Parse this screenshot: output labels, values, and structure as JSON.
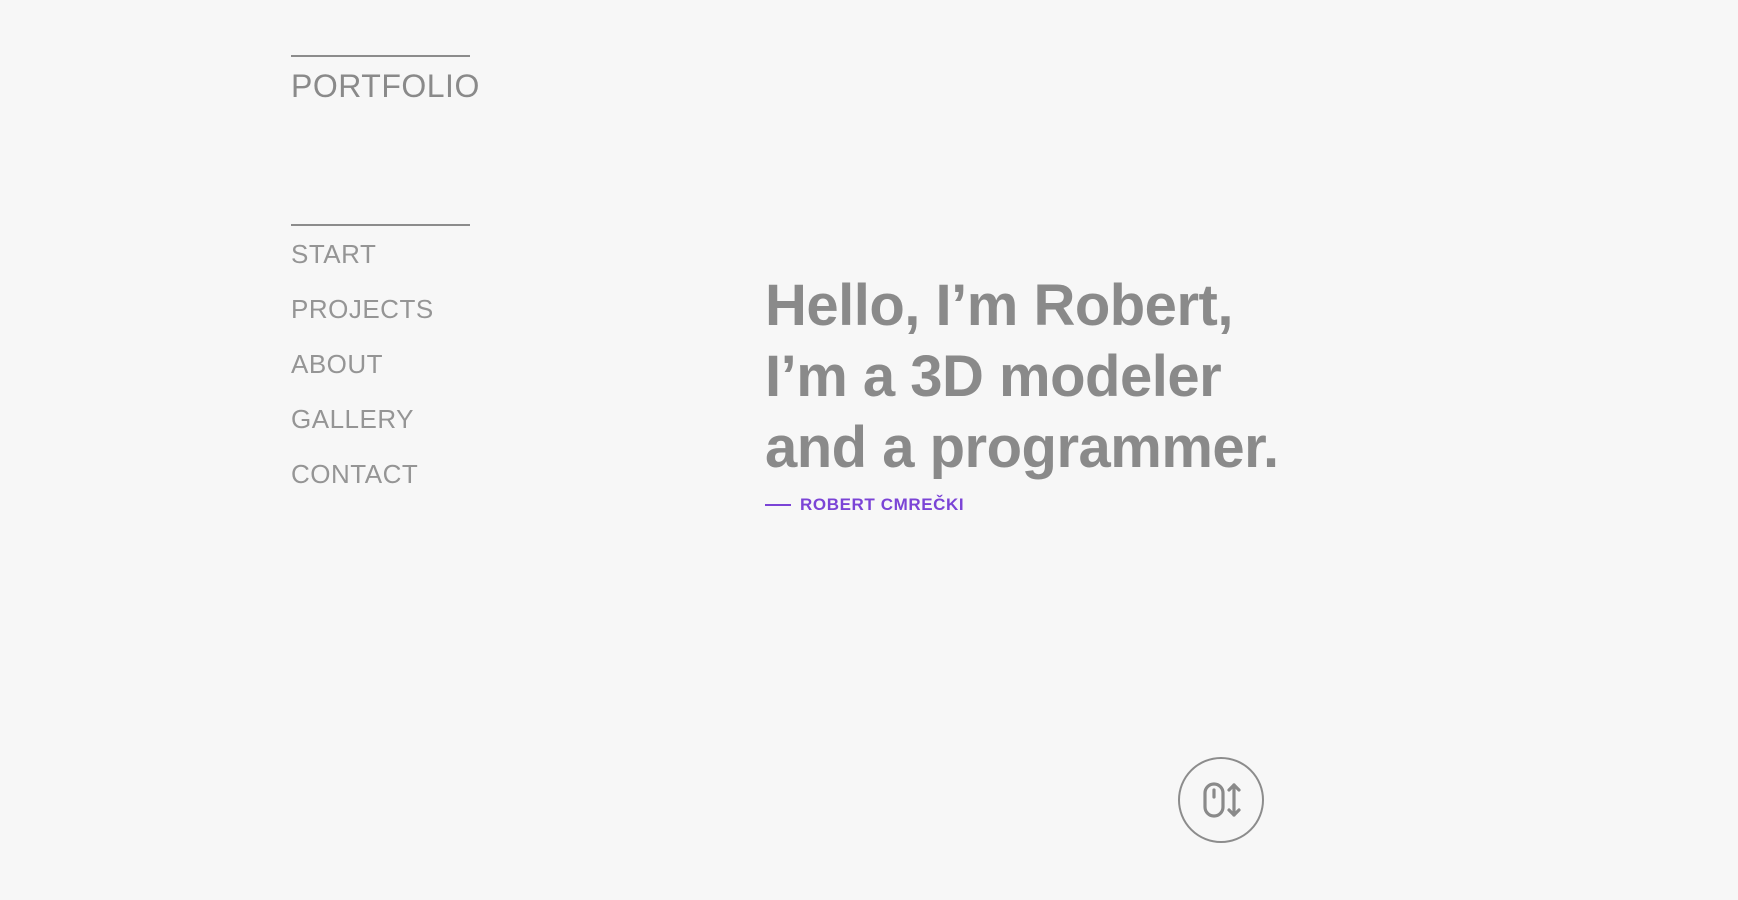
{
  "brand": {
    "title": "PORTFOLIO"
  },
  "nav": {
    "items": [
      {
        "label": "START"
      },
      {
        "label": "PROJECTS"
      },
      {
        "label": "ABOUT"
      },
      {
        "label": "GALLERY"
      },
      {
        "label": "CONTACT"
      }
    ]
  },
  "hero": {
    "lines": [
      "Hello, I’m Robert,",
      "I’m a 3D modeler",
      "and a programmer."
    ],
    "signature": "ROBERT CMREČKI"
  },
  "scroll_indicator": {
    "icon": "mouse-scroll-icon"
  },
  "colors": {
    "background": "#f7f7f7",
    "text": "#8a8a8a",
    "accent": "#7b44d6"
  }
}
